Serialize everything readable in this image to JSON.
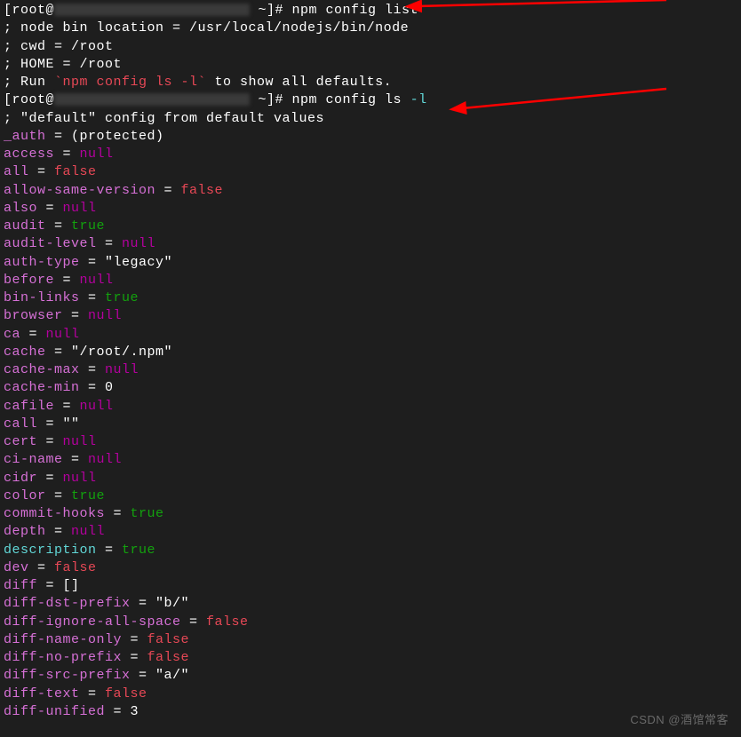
{
  "prompt1_prefix": "[root@",
  "prompt1_suffix": " ~]# ",
  "cmd1": "npm config list",
  "node_bin": "; node bin location = /usr/local/nodejs/bin/node",
  "cwd": "; cwd = /root",
  "home": "; HOME = /root",
  "run_prefix": "; Run ",
  "run_cmd": "`npm config ls -l`",
  "run_suffix": " to show all defaults.",
  "prompt2_prefix": "[root@",
  "prompt2_suffix": " ~]# ",
  "cmd2_a": "npm config ls ",
  "cmd2_b": "-l",
  "default_header": "; \"default\" config from default values",
  "config": [
    {
      "key": "_auth",
      "val": "(protected)",
      "type": "str"
    },
    {
      "key": "access",
      "val": "null",
      "type": "null"
    },
    {
      "key": "all",
      "val": "false",
      "type": "false"
    },
    {
      "key": "allow-same-version",
      "val": "false",
      "type": "false"
    },
    {
      "key": "also",
      "val": "null",
      "type": "null"
    },
    {
      "key": "audit",
      "val": "true",
      "type": "true"
    },
    {
      "key": "audit-level",
      "val": "null",
      "type": "null"
    },
    {
      "key": "auth-type",
      "val": "\"legacy\"",
      "type": "str"
    },
    {
      "key": "before",
      "val": "null",
      "type": "null"
    },
    {
      "key": "bin-links",
      "val": "true",
      "type": "true"
    },
    {
      "key": "browser",
      "val": "null",
      "type": "null"
    },
    {
      "key": "ca",
      "val": "null",
      "type": "null"
    },
    {
      "key": "cache",
      "val": "\"/root/.npm\"",
      "type": "str"
    },
    {
      "key": "cache-max",
      "val": "null",
      "type": "null"
    },
    {
      "key": "cache-min",
      "val": "0",
      "type": "num"
    },
    {
      "key": "cafile",
      "val": "null",
      "type": "null"
    },
    {
      "key": "call",
      "val": "\"\"",
      "type": "str"
    },
    {
      "key": "cert",
      "val": "null",
      "type": "null"
    },
    {
      "key": "ci-name",
      "val": "null",
      "type": "null"
    },
    {
      "key": "cidr",
      "val": "null",
      "type": "null"
    },
    {
      "key": "color",
      "val": "true",
      "type": "true"
    },
    {
      "key": "commit-hooks",
      "val": "true",
      "type": "true"
    },
    {
      "key": "depth",
      "val": "null",
      "type": "null"
    },
    {
      "key": "description",
      "val": "true",
      "type": "true",
      "keyClass": "desc-key"
    },
    {
      "key": "dev",
      "val": "false",
      "type": "false"
    },
    {
      "key": "diff",
      "val": "[]",
      "type": "str"
    },
    {
      "key": "diff-dst-prefix",
      "val": "\"b/\"",
      "type": "str"
    },
    {
      "key": "diff-ignore-all-space",
      "val": "false",
      "type": "false"
    },
    {
      "key": "diff-name-only",
      "val": "false",
      "type": "false"
    },
    {
      "key": "diff-no-prefix",
      "val": "false",
      "type": "false"
    },
    {
      "key": "diff-src-prefix",
      "val": "\"a/\"",
      "type": "str"
    },
    {
      "key": "diff-text",
      "val": "false",
      "type": "false"
    },
    {
      "key": "diff-unified",
      "val": "3",
      "type": "num"
    }
  ],
  "watermark": "CSDN @酒馆常客"
}
